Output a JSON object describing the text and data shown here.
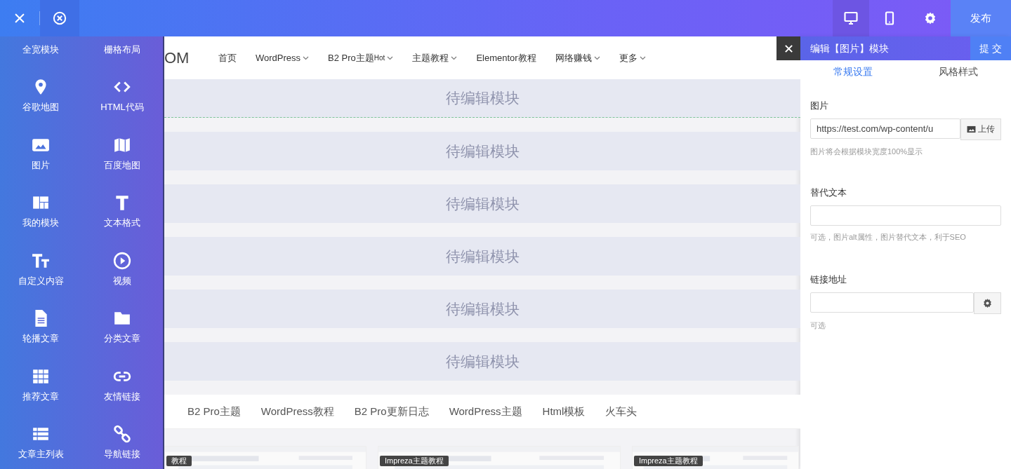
{
  "top_bar": {
    "devices": [
      {
        "kind": "desktop",
        "selected": true
      },
      {
        "kind": "mobile",
        "selected": false
      }
    ],
    "publish_button": "发布"
  },
  "sidebar": {
    "items": [
      {
        "label": "全宽模块"
      },
      {
        "label": "栅格布局"
      },
      {
        "label": "谷歌地图"
      },
      {
        "label": "HTML代码"
      },
      {
        "label": "图片"
      },
      {
        "label": "百度地图"
      },
      {
        "label": "我的模块"
      },
      {
        "label": "文本格式"
      },
      {
        "label": "自定义内容"
      },
      {
        "label": "视频"
      },
      {
        "label": "轮播文章"
      },
      {
        "label": "分类文章"
      },
      {
        "label": "推荐文章"
      },
      {
        "label": "友情链接"
      },
      {
        "label": "文章主列表"
      },
      {
        "label": "导航链接"
      }
    ]
  },
  "preview": {
    "logo": "OM",
    "nav": [
      {
        "label": "首页",
        "dropdown": false
      },
      {
        "label": "WordPress",
        "dropdown": true
      },
      {
        "label": "B2 Pro主题",
        "badge": "Hot",
        "dropdown": true
      },
      {
        "label": "主题教程",
        "dropdown": true
      },
      {
        "label": "Elementor教程",
        "dropdown": false
      },
      {
        "label": "网络赚钱",
        "dropdown": true
      },
      {
        "label": "更多",
        "dropdown": true
      }
    ],
    "modules": [
      {
        "label": "待编辑模块",
        "selected": true
      },
      {
        "label": "待编辑模块",
        "selected": false
      },
      {
        "label": "待编辑模块",
        "selected": false
      },
      {
        "label": "待编辑模块",
        "selected": false
      },
      {
        "label": "待编辑模块",
        "selected": false
      },
      {
        "label": "待编辑模块",
        "selected": false
      }
    ],
    "tabs": [
      {
        "label": "B2 Pro主题"
      },
      {
        "label": "WordPress教程"
      },
      {
        "label": "B2 Pro更新日志"
      },
      {
        "label": "WordPress主题"
      },
      {
        "label": "Html模板"
      },
      {
        "label": "火车头"
      }
    ],
    "cards": [
      {
        "tag": "教程"
      },
      {
        "tag": "Impreza主题教程"
      },
      {
        "tag": "Impreza主题教程"
      }
    ]
  },
  "editor": {
    "title": "编辑【图片】模块",
    "submit_button": "提 交",
    "tabs": [
      {
        "label": "常规设置",
        "selected": true
      },
      {
        "label": "风格样式",
        "selected": false
      }
    ],
    "fields": [
      {
        "kind": "upload",
        "label": "图片",
        "value": "https://test.com/wp-content/u",
        "button": "上传",
        "hint": "图片将会根据模块宽度100%显示"
      },
      {
        "kind": "text",
        "label": "替代文本",
        "hint": "可选，图片alt属性，图片替代文本，利于SEO"
      },
      {
        "kind": "settings",
        "label": "链接地址",
        "hint": "可选"
      }
    ]
  }
}
